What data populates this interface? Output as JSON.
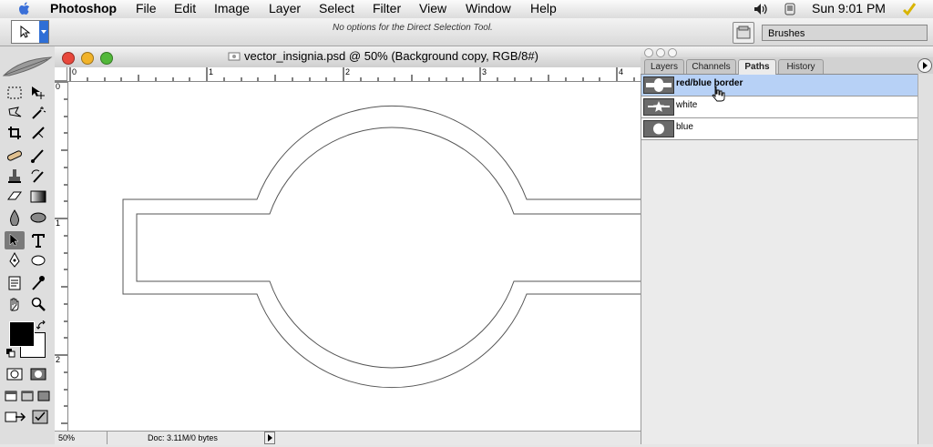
{
  "menubar": {
    "app_name": "Photoshop",
    "items": [
      "File",
      "Edit",
      "Image",
      "Layer",
      "Select",
      "Filter",
      "View",
      "Window",
      "Help"
    ],
    "clock": "Sun 9:01 PM"
  },
  "options_bar": {
    "message": "No options for the Direct Selection Tool.",
    "palette_well_tab": "Brushes"
  },
  "document": {
    "title": "vector_insignia.psd @ 50% (Background copy, RGB/8#)",
    "ruler_h_labels": [
      "0",
      "1",
      "2",
      "3",
      "4"
    ],
    "ruler_v_labels": [
      "0",
      "1",
      "2"
    ],
    "zoom": "50%",
    "doc_info": "Doc: 3.11M/0 bytes"
  },
  "palette": {
    "tabs": [
      "Layers",
      "Channels",
      "Paths",
      "History"
    ],
    "active_tab": "Paths",
    "paths": [
      {
        "name": "red/blue border",
        "selected": true
      },
      {
        "name": "white",
        "selected": false
      },
      {
        "name": "blue",
        "selected": false
      }
    ]
  },
  "colors": {
    "foreground": "#000000",
    "background": "#ffffff",
    "selection_highlight": "#b7d1f6"
  }
}
